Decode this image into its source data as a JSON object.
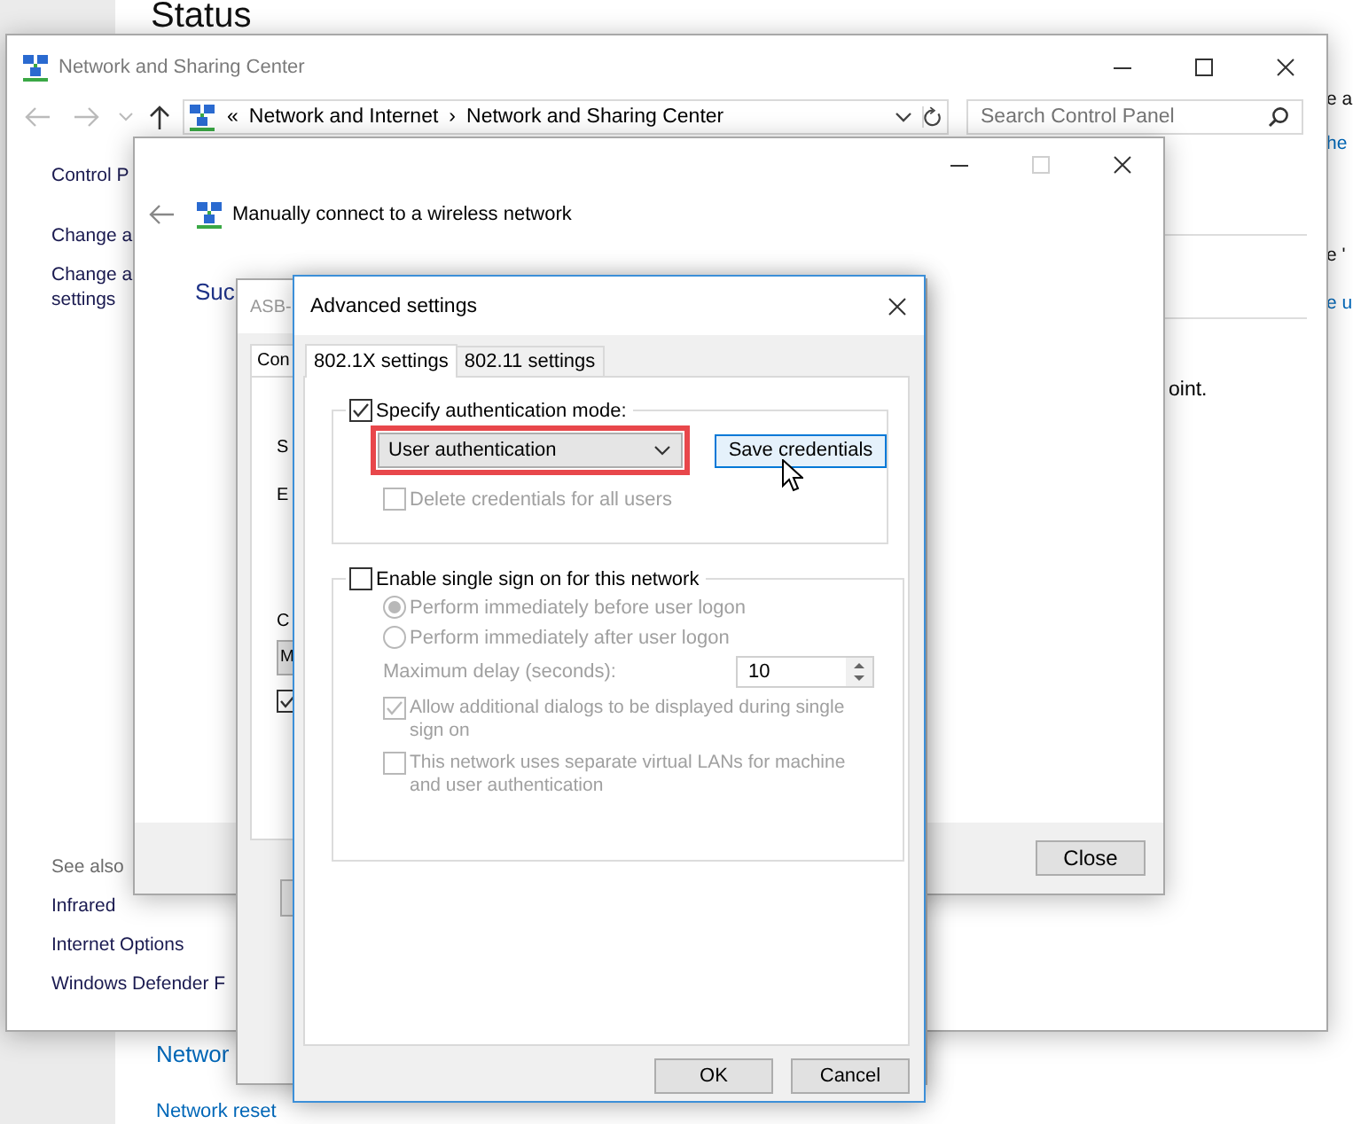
{
  "background_page": {
    "heading": "Status",
    "right_texts": [
      {
        "text": "e a",
        "kind": "text"
      },
      {
        "text": "he",
        "kind": "link"
      },
      {
        "text": "e '",
        "kind": "text"
      },
      {
        "text": "e u",
        "kind": "link"
      }
    ],
    "bottom_links": [
      "Networ",
      "Network reset"
    ]
  },
  "network_center": {
    "title": "Network and Sharing Center",
    "address": {
      "prefix": "«",
      "crumbs": [
        "Network and Internet",
        "Network and Sharing Center"
      ],
      "separator": "›"
    },
    "search": {
      "placeholder": "Search Control Panel"
    },
    "sidebar": {
      "items": [
        "Control P",
        "Change a",
        "Change a\nsettings"
      ],
      "see_also": {
        "heading": "See also",
        "links": [
          "Infrared",
          "Internet Options",
          "Windows Defender F"
        ]
      }
    },
    "content_fragment": "oint."
  },
  "manual_connect": {
    "title": "Manually connect to a wireless network",
    "heading": "Suc",
    "close_button": "Close"
  },
  "properties": {
    "title": "ASB-",
    "tab": "Con",
    "labels": [
      "S",
      "E",
      "C"
    ],
    "select_value": "M",
    "option": {
      "checked": true
    }
  },
  "advanced": {
    "title": "Advanced settings",
    "tabs": [
      {
        "label": "802.1X settings",
        "selected": true
      },
      {
        "label": "802.11 settings",
        "selected": false
      }
    ],
    "auth_group": {
      "checkbox": {
        "label": "Specify authentication mode:",
        "checked": true
      },
      "mode": {
        "value": "User authentication",
        "highlighted": true
      },
      "save_button": "Save credentials",
      "delete_option": {
        "label": "Delete credentials for all users",
        "checked": false,
        "disabled": true
      }
    },
    "sso_group": {
      "checkbox": {
        "label": "Enable single sign on for this network",
        "checked": false
      },
      "options": [
        {
          "kind": "radio",
          "label": "Perform immediately before user logon",
          "selected": true,
          "disabled": true
        },
        {
          "kind": "radio",
          "label": "Perform immediately after user logon",
          "selected": false,
          "disabled": true
        },
        {
          "kind": "spinner",
          "label": "Maximum delay (seconds):",
          "value": "10",
          "disabled": true
        },
        {
          "kind": "checkbox",
          "label": "Allow additional dialogs to be displayed during single sign on",
          "checked": true,
          "disabled": true
        },
        {
          "kind": "checkbox",
          "label": "This network uses separate virtual LANs for machine and user authentication",
          "checked": false,
          "disabled": true
        }
      ]
    },
    "buttons": [
      "OK",
      "Cancel"
    ]
  }
}
